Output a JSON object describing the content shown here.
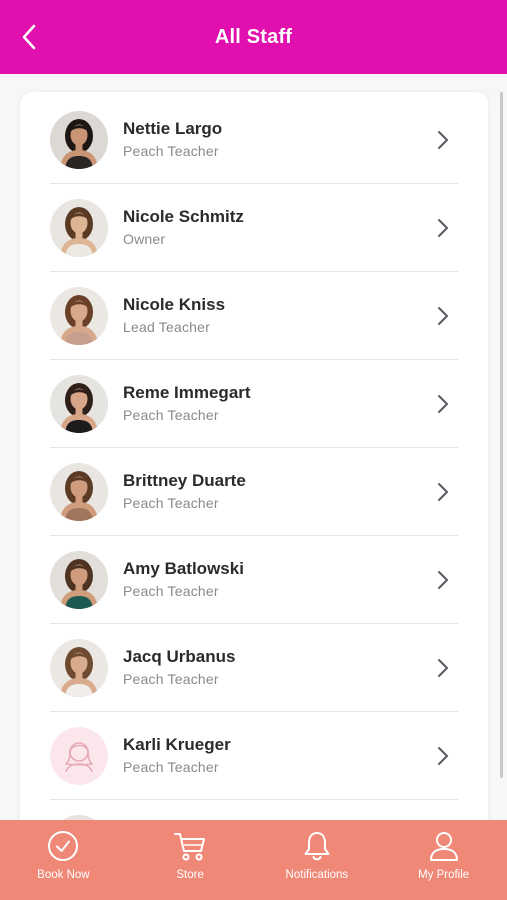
{
  "header": {
    "title": "All Staff"
  },
  "staff": [
    {
      "name": "Nettie Largo",
      "role": "Peach Teacher",
      "bg": "#dcd8d4",
      "hair": "#1e1612",
      "top": "#2a2624",
      "skin": "#c99575"
    },
    {
      "name": "Nicole Schmitz",
      "role": "Owner",
      "bg": "#e9e6e2",
      "hair": "#5a3a24",
      "top": "#ece8e2",
      "skin": "#ddb594"
    },
    {
      "name": "Nicole Kniss",
      "role": "Lead Teacher",
      "bg": "#ebe7e3",
      "hair": "#6a4128",
      "top": "#c89e8f",
      "skin": "#d8a88a"
    },
    {
      "name": "Reme Immegart",
      "role": "Peach Teacher",
      "bg": "#e6e4e1",
      "hair": "#2e1f18",
      "top": "#1c1c1c",
      "skin": "#d7a588"
    },
    {
      "name": "Brittney Duarte",
      "role": "Peach Teacher",
      "bg": "#e9e6e2",
      "hair": "#5b3a26",
      "top": "#a1765c",
      "skin": "#cf9c7d"
    },
    {
      "name": "Amy Batlowski",
      "role": "Peach Teacher",
      "bg": "#e2ded9",
      "hair": "#4e3222",
      "top": "#1f5a52",
      "skin": "#cf9d7c"
    },
    {
      "name": "Jacq Urbanus",
      "role": "Peach Teacher",
      "bg": "#ebe8e4",
      "hair": "#6e4a30",
      "top": "#f1ede8",
      "skin": "#d9ab8d"
    },
    {
      "name": "Karli Krueger",
      "role": "Peach Teacher",
      "placeholder": true
    }
  ],
  "tabs": [
    {
      "label": "Book Now",
      "icon": "check-circle-icon"
    },
    {
      "label": "Store",
      "icon": "cart-icon"
    },
    {
      "label": "Notifications",
      "icon": "bell-icon"
    },
    {
      "label": "My Profile",
      "icon": "user-icon"
    }
  ],
  "colors": {
    "header": "#e10fad",
    "tabbar": "#f08878",
    "placeholder_bg": "#fbe6ec",
    "placeholder_icon": "#e7a9ba"
  }
}
